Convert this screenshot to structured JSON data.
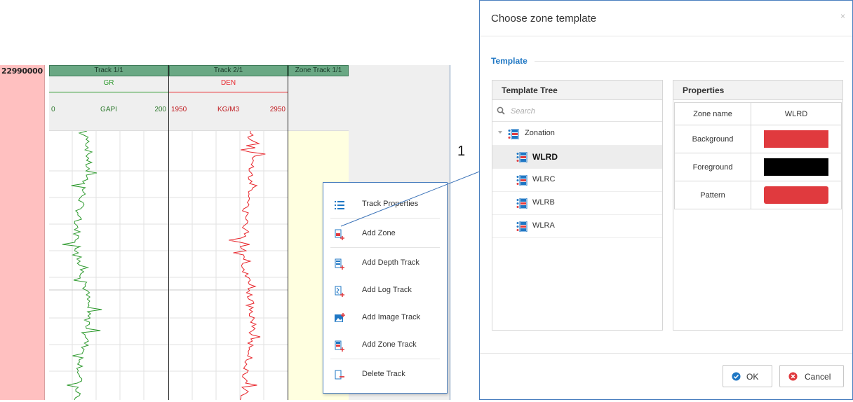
{
  "plot": {
    "depth_label": "22990000",
    "tracks": [
      {
        "title": "Track 1/1",
        "curve": "GR",
        "min": "0",
        "unit": "GAPI",
        "max": "200",
        "color": "#2e9a2e"
      },
      {
        "title": "Track 2/1",
        "curve": "DEN",
        "min": "1950",
        "unit": "KG/M3",
        "max": "2950",
        "color": "#e8242a"
      },
      {
        "title": "Zone Track 1/1",
        "background": "#ffffe0"
      }
    ]
  },
  "context_menu": {
    "items": [
      {
        "label": "Track Properties",
        "icon": "list-icon"
      },
      {
        "label": "Add Zone",
        "icon": "add-zone-icon"
      },
      {
        "label": "Add Depth Track",
        "icon": "add-depth-track-icon"
      },
      {
        "label": "Add Log Track",
        "icon": "add-log-track-icon"
      },
      {
        "label": "Add Image Track",
        "icon": "add-image-track-icon"
      },
      {
        "label": "Add Zone Track",
        "icon": "add-zone-track-icon"
      },
      {
        "label": "Delete Track",
        "icon": "delete-track-icon"
      }
    ]
  },
  "annotation": {
    "number": "1"
  },
  "dialog": {
    "title": "Choose zone template",
    "close": "×",
    "section_label": "Template",
    "tree": {
      "header": "Template Tree",
      "search_placeholder": "Search",
      "root": "Zonation",
      "items": [
        "WLRD",
        "WLRC",
        "WLRB",
        "WLRA"
      ],
      "selected": "WLRD"
    },
    "properties": {
      "header": "Properties",
      "zone_name_label": "Zone name",
      "zone_name_value": "WLRD",
      "background_label": "Background",
      "background_color": "#e03a3e",
      "foreground_label": "Foreground",
      "foreground_color": "#000000",
      "pattern_label": "Pattern",
      "pattern_color": "#e03a3e"
    },
    "buttons": {
      "ok": "OK",
      "cancel": "Cancel"
    },
    "accent_color": "#1f77c4"
  }
}
